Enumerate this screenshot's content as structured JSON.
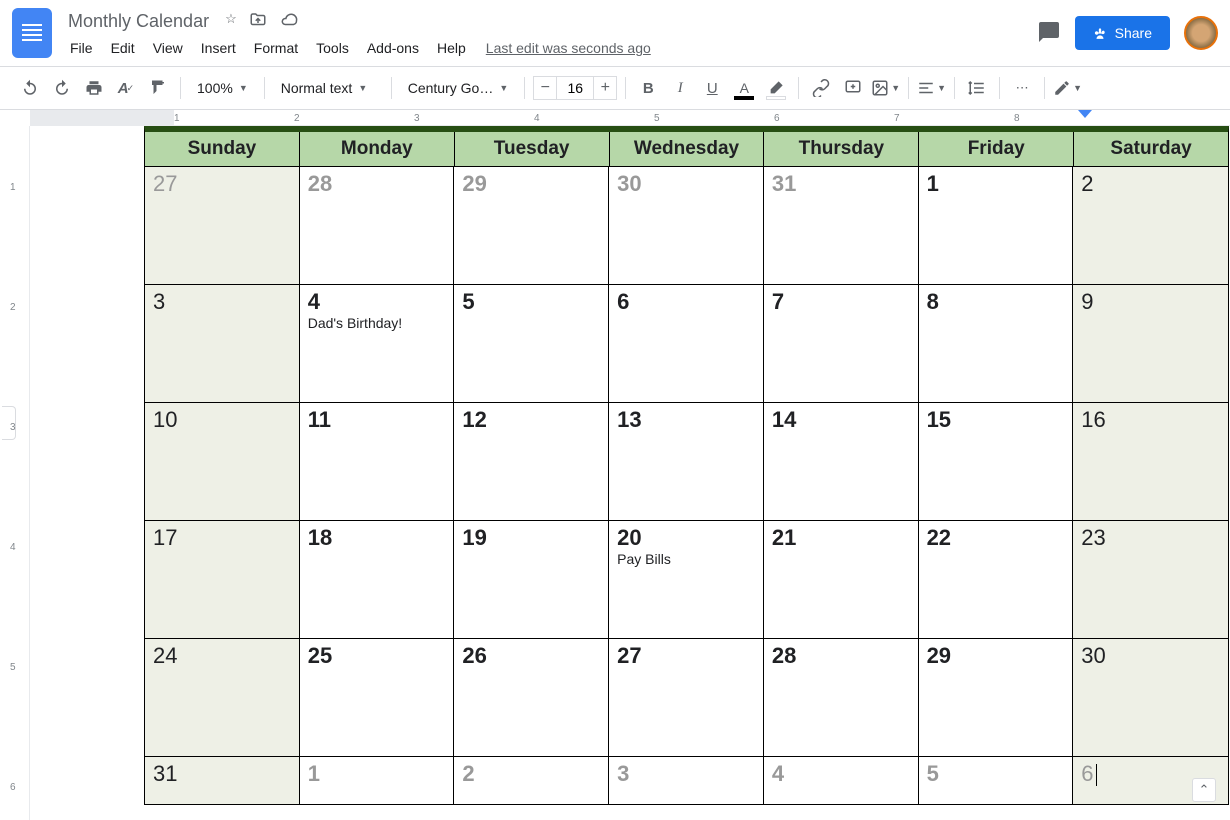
{
  "doc": {
    "title": "Monthly Calendar"
  },
  "menu": {
    "items": [
      "File",
      "Edit",
      "View",
      "Insert",
      "Format",
      "Tools",
      "Add-ons",
      "Help"
    ],
    "last_edit": "Last edit was seconds ago"
  },
  "share": {
    "label": "Share"
  },
  "toolbar": {
    "zoom": "100%",
    "style": "Normal text",
    "font": "Century Go…",
    "font_size": "16"
  },
  "ruler_h": [
    "1",
    "2",
    "3",
    "4",
    "5",
    "6",
    "7",
    "8"
  ],
  "ruler_v": [
    "1",
    "2",
    "3",
    "4",
    "5",
    "6"
  ],
  "calendar": {
    "days": [
      "Sunday",
      "Monday",
      "Tuesday",
      "Wednesday",
      "Thursday",
      "Friday",
      "Saturday"
    ],
    "weeks": [
      [
        {
          "d": "27",
          "muted": true,
          "weekend": true
        },
        {
          "d": "28",
          "muted": true,
          "bold": true
        },
        {
          "d": "29",
          "muted": true,
          "bold": true
        },
        {
          "d": "30",
          "muted": true,
          "bold": true
        },
        {
          "d": "31",
          "muted": true,
          "bold": true
        },
        {
          "d": "1",
          "bold": true
        },
        {
          "d": "2",
          "weekend": true
        }
      ],
      [
        {
          "d": "3",
          "weekend": true
        },
        {
          "d": "4",
          "bold": true,
          "event": "Dad's Birthday!"
        },
        {
          "d": "5",
          "bold": true
        },
        {
          "d": "6",
          "bold": true
        },
        {
          "d": "7",
          "bold": true
        },
        {
          "d": "8",
          "bold": true
        },
        {
          "d": "9",
          "weekend": true
        }
      ],
      [
        {
          "d": "10",
          "weekend": true
        },
        {
          "d": "11",
          "bold": true
        },
        {
          "d": "12",
          "bold": true
        },
        {
          "d": "13",
          "bold": true
        },
        {
          "d": "14",
          "bold": true
        },
        {
          "d": "15",
          "bold": true
        },
        {
          "d": "16",
          "weekend": true
        }
      ],
      [
        {
          "d": "17",
          "weekend": true
        },
        {
          "d": "18",
          "bold": true
        },
        {
          "d": "19",
          "bold": true
        },
        {
          "d": "20",
          "bold": true,
          "event": "Pay Bills"
        },
        {
          "d": "21",
          "bold": true
        },
        {
          "d": "22",
          "bold": true
        },
        {
          "d": "23",
          "weekend": true
        }
      ],
      [
        {
          "d": "24",
          "weekend": true
        },
        {
          "d": "25",
          "bold": true
        },
        {
          "d": "26",
          "bold": true
        },
        {
          "d": "27",
          "bold": true
        },
        {
          "d": "28",
          "bold": true
        },
        {
          "d": "29",
          "bold": true
        },
        {
          "d": "30",
          "weekend": true
        }
      ],
      [
        {
          "d": "31",
          "weekend": true
        },
        {
          "d": "1",
          "muted": true,
          "bold": true
        },
        {
          "d": "2",
          "muted": true,
          "bold": true
        },
        {
          "d": "3",
          "muted": true,
          "bold": true
        },
        {
          "d": "4",
          "muted": true,
          "bold": true
        },
        {
          "d": "5",
          "muted": true,
          "bold": true
        },
        {
          "d": "6",
          "muted": true,
          "weekend": true,
          "cursor": true
        }
      ]
    ]
  }
}
